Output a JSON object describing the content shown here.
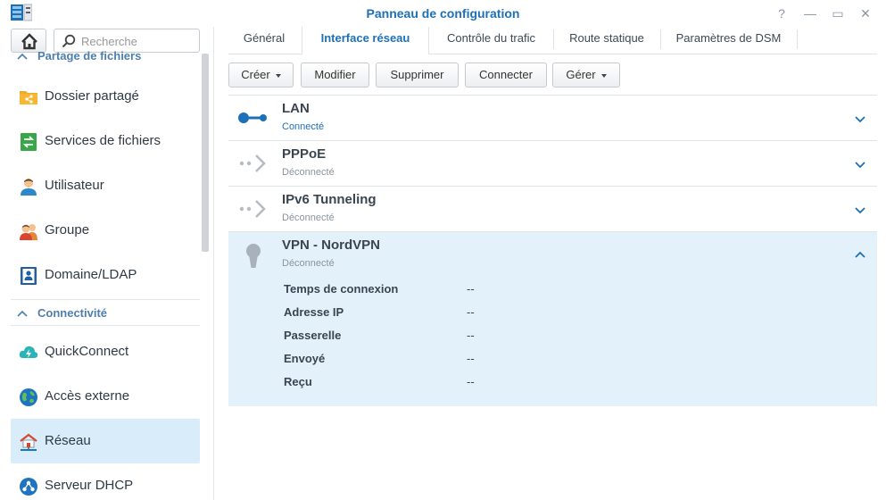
{
  "window": {
    "title": "Panneau de configuration",
    "help_glyph": "?",
    "minimize_glyph": "—",
    "maximize_glyph": "▭",
    "close_glyph": "✕"
  },
  "search": {
    "placeholder": "Recherche",
    "value": ""
  },
  "sidebar": {
    "sections": [
      {
        "title": "Partage de fichiers",
        "items": [
          {
            "label": "Dossier partagé",
            "icon": "shared-folder-icon"
          },
          {
            "label": "Services de fichiers",
            "icon": "file-services-icon"
          },
          {
            "label": "Utilisateur",
            "icon": "user-icon"
          },
          {
            "label": "Groupe",
            "icon": "group-icon"
          },
          {
            "label": "Domaine/LDAP",
            "icon": "domain-ldap-icon"
          }
        ]
      },
      {
        "title": "Connectivité",
        "items": [
          {
            "label": "QuickConnect",
            "icon": "quickconnect-icon"
          },
          {
            "label": "Accès externe",
            "icon": "external-access-icon"
          },
          {
            "label": "Réseau",
            "icon": "network-icon",
            "selected": true
          },
          {
            "label": "Serveur DHCP",
            "icon": "dhcp-server-icon"
          }
        ]
      }
    ]
  },
  "tabs": [
    {
      "label": "Général"
    },
    {
      "label": "Interface réseau",
      "active": true
    },
    {
      "label": "Contrôle du trafic"
    },
    {
      "label": "Route statique"
    },
    {
      "label": "Paramètres de DSM"
    }
  ],
  "toolbar": {
    "create_label": "Créer",
    "modify_label": "Modifier",
    "delete_label": "Supprimer",
    "connect_label": "Connecter",
    "manage_label": "Gérer"
  },
  "interfaces": [
    {
      "name": "LAN",
      "status": "Connecté",
      "icon": "lan-connected-icon",
      "expanded": false
    },
    {
      "name": "PPPoE",
      "status": "Déconnecté",
      "icon": "pppoe-disconnected-icon",
      "expanded": false
    },
    {
      "name": "IPv6 Tunneling",
      "status": "Déconnecté",
      "icon": "ipv6-tunnel-icon",
      "expanded": false
    },
    {
      "name": "VPN - NordVPN",
      "status": "Déconnecté",
      "icon": "vpn-keyhole-icon",
      "expanded": true,
      "details": [
        {
          "label": "Temps de connexion",
          "value": "--"
        },
        {
          "label": "Adresse IP",
          "value": "--"
        },
        {
          "label": "Passerelle",
          "value": "--"
        },
        {
          "label": "Envoyé",
          "value": "--"
        },
        {
          "label": "Reçu",
          "value": "--"
        }
      ]
    }
  ],
  "colors": {
    "accent": "#1d70b8",
    "selected_bg": "#d9ecfa",
    "expanded_bg": "#e3f1fb"
  }
}
